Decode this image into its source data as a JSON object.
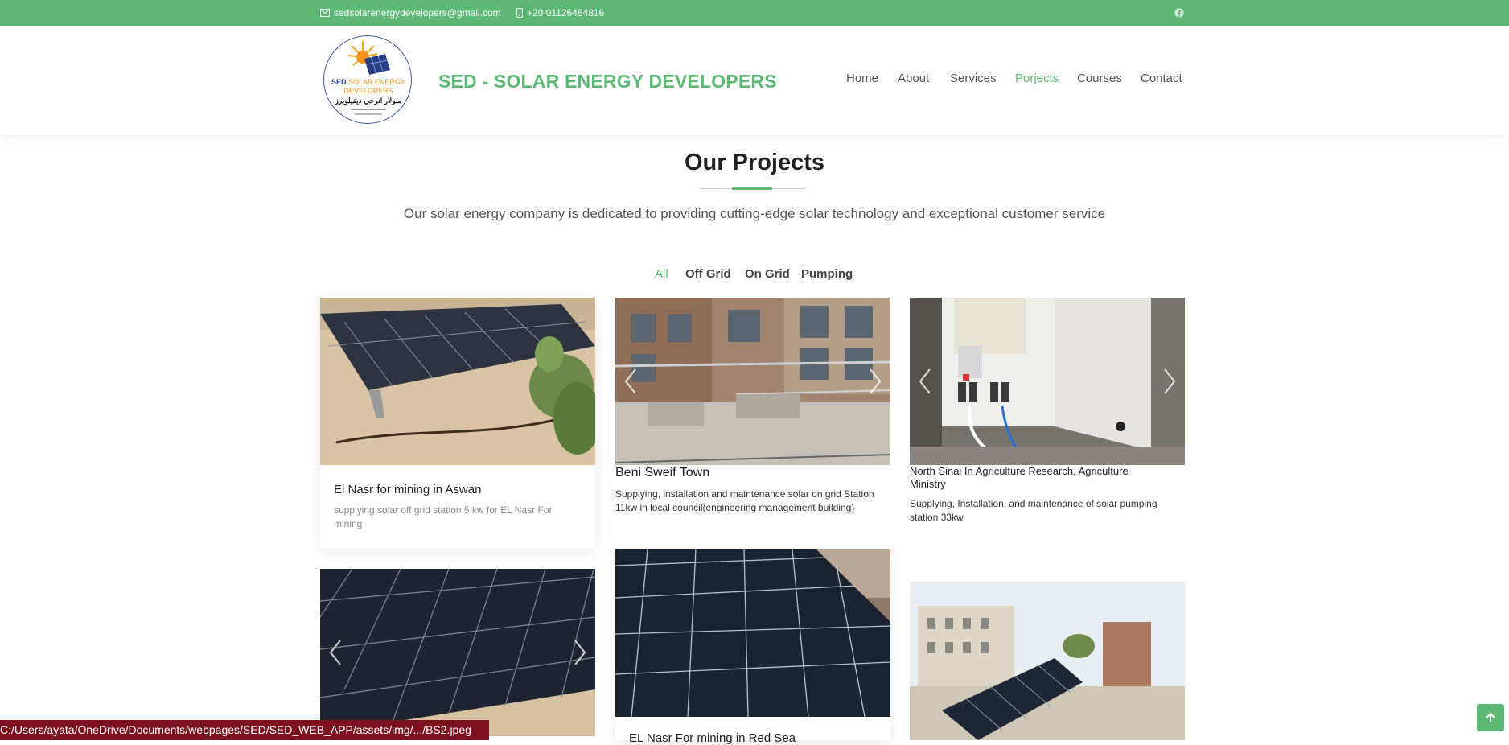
{
  "topbar": {
    "email": "sedsolarenergydevelopers@gmail.com",
    "phone": "+20 01126464816",
    "colors": {
      "bar": "#5cb874",
      "text": "#ffffff"
    }
  },
  "header": {
    "brand": "SED - SOLAR ENERGY DEVELOPERS",
    "logo": {
      "line1": "SED",
      "line2": "SOLAR ENERGY",
      "line3": "DEVELOPERS",
      "arabic": "سولار انرجي ديفيلوبرز"
    },
    "nav": [
      "Home",
      "About",
      "Services",
      "Porjects",
      "Courses",
      "Contact"
    ],
    "active_nav": "Porjects"
  },
  "projects": {
    "title": "Our Projects",
    "subtitle": "Our solar energy company is dedicated to providing cutting-edge solar technology and exceptional customer service",
    "filters": [
      "All",
      "Off Grid",
      "On Grid",
      "Pumping"
    ],
    "active_filter": "All",
    "items": [
      {
        "title": "El Nasr for mining in Aswan",
        "desc": "supplying solar off grid station 5 kw for EL Nasr For mining"
      },
      {
        "title": "Beni Sweif Town",
        "desc": "Supplying, installation and maintenance solar on grid Station 11kw in local council(engineering management building)"
      },
      {
        "title": "North Sinai In Agriculture Research, Agriculture Ministry",
        "desc": "Supplying, Installation, and maintenance of solar pumping station 33kw"
      },
      {
        "title": "",
        "desc": ""
      },
      {
        "title": "EL Nasr For mining in Red Sea",
        "desc": ""
      },
      {
        "title": "",
        "desc": ""
      }
    ]
  },
  "statusbar": {
    "url": "C:/Users/ayata/OneDrive/Documents/webpages/SED/SED_WEB_APP/assets/img/.../BS2.jpeg"
  },
  "icons": {
    "email": "envelope-icon",
    "phone": "mobile-phone-icon",
    "social": "facebook-icon",
    "back_to_top": "arrow-up-icon"
  },
  "accent_color": "#5cb874"
}
